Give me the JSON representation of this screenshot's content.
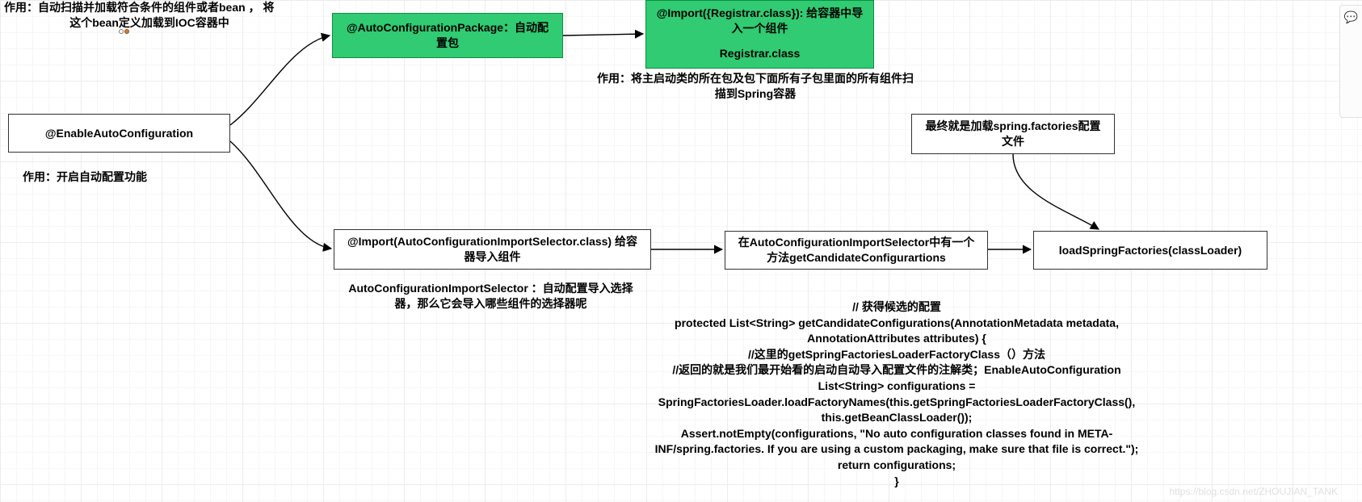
{
  "top_note": {
    "line1": "作用：自动扫描并加载符合条件的组件或者bean  ， 将",
    "line2": "这个bean定义加载到IOC容器中"
  },
  "nodes": {
    "enable": {
      "label": "@EnableAutoConfiguration",
      "caption": "作用：开启自动配置功能"
    },
    "pkg": {
      "label": "@AutoConfigurationPackage：自动配置包"
    },
    "reg": {
      "line1": "@Import({Registrar.class}): 给容器中导入一个组件",
      "line3": "Registrar.class",
      "caption": "作用：将主启动类的所在包及包下面所有子包里面的所有组件扫描到Spring容器"
    },
    "imp": {
      "label": "@Import(AutoConfigurationImportSelector.class)  给容器导入组件",
      "caption": "AutoConfigurationImportSelector  ：自动配置导入选择器，那么它会导入哪些组件的选择器呢"
    },
    "cand": {
      "label": "在AutoConfigurationImportSelector中有一个方法getCandidateConfigurartions"
    },
    "load": {
      "label": "loadSpringFactories(classLoader)",
      "caption": "最终就是加载spring.factories配置文件"
    }
  },
  "code": {
    "l1": "//  获得候选的配置",
    "l2": "protected List<String> getCandidateConfigurations(AnnotationMetadata metadata,",
    "l3": "AnnotationAttributes attributes) {",
    "l4": "//这里的getSpringFactoriesLoaderFactoryClass（）方法",
    "l5": "//返回的就是我们最开始看的启动自动导入配置文件的注解类；EnableAutoConfiguration",
    "l6": "List<String> configurations =",
    "l7": "SpringFactoriesLoader.loadFactoryNames(this.getSpringFactoriesLoaderFactoryClass(),",
    "l8": "this.getBeanClassLoader());",
    "l9": "Assert.notEmpty(configurations, \"No auto configuration classes found in META-",
    "l10": "INF/spring.factories. If you are using a custom packaging, make sure that file is correct.\");",
    "l11": "return configurations;",
    "l12": "}"
  },
  "watermark": "https://blog.csdn.net/ZHOUJIAN_TANK",
  "icons": {
    "chat": "💬"
  }
}
